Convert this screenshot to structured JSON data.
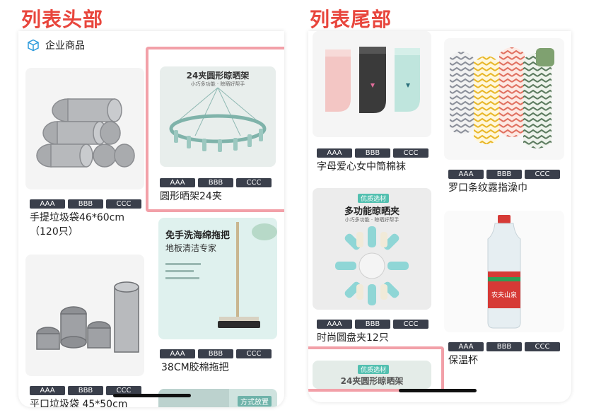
{
  "labels": {
    "list_header": "列表头部",
    "list_footer": "列表尾部"
  },
  "left": {
    "category_title": "企业商品",
    "cards": [
      {
        "title": "手提垃圾袋46*60cm（120只）",
        "tags": [
          "AAA",
          "BBB",
          "CCC"
        ]
      },
      {
        "title": "圆形晒架24夹",
        "tags": [
          "AAA",
          "BBB",
          "CCC"
        ],
        "image_caption": "24夹圆形晾晒架",
        "image_sub": "小巧多功能 · 晾晒好帮手"
      },
      {
        "title": "38CM胶棉拖把",
        "tags": [
          "AAA",
          "BBB",
          "CCC"
        ],
        "image_caption": "免手洗海绵拖把",
        "image_sub": "地板清洁专家"
      },
      {
        "title": "平口垃圾袋 45*50cm",
        "tags": [
          "AAA",
          "BBB",
          "CCC"
        ]
      },
      {
        "image_caption": "方式放置"
      }
    ]
  },
  "right": {
    "cards": [
      {
        "title": "字母爱心女中筒棉袜",
        "tags": [
          "AAA",
          "BBB",
          "CCC"
        ]
      },
      {
        "title": "罗口条纹露指澡巾",
        "tags": [
          "AAA",
          "BBB",
          "CCC"
        ]
      },
      {
        "title": "时尚圆盘夹12只",
        "tags": [
          "AAA",
          "BBB",
          "CCC"
        ],
        "image_badge": "优质选材",
        "image_caption": "多功能晾晒夹",
        "image_sub": "小巧多功能 · 晾晒好帮手"
      },
      {
        "title": "保温杯",
        "tags": [
          "AAA",
          "BBB",
          "CCC"
        ],
        "image_caption": "农夫山泉"
      },
      {
        "image_badge": "优质选材",
        "image_caption": "24夹圆形晾晒架"
      }
    ]
  },
  "colors": {
    "label_red": "#e8453c",
    "highlight_pink": "#f2a0a8",
    "tag_bg": "#3a3f4b"
  }
}
